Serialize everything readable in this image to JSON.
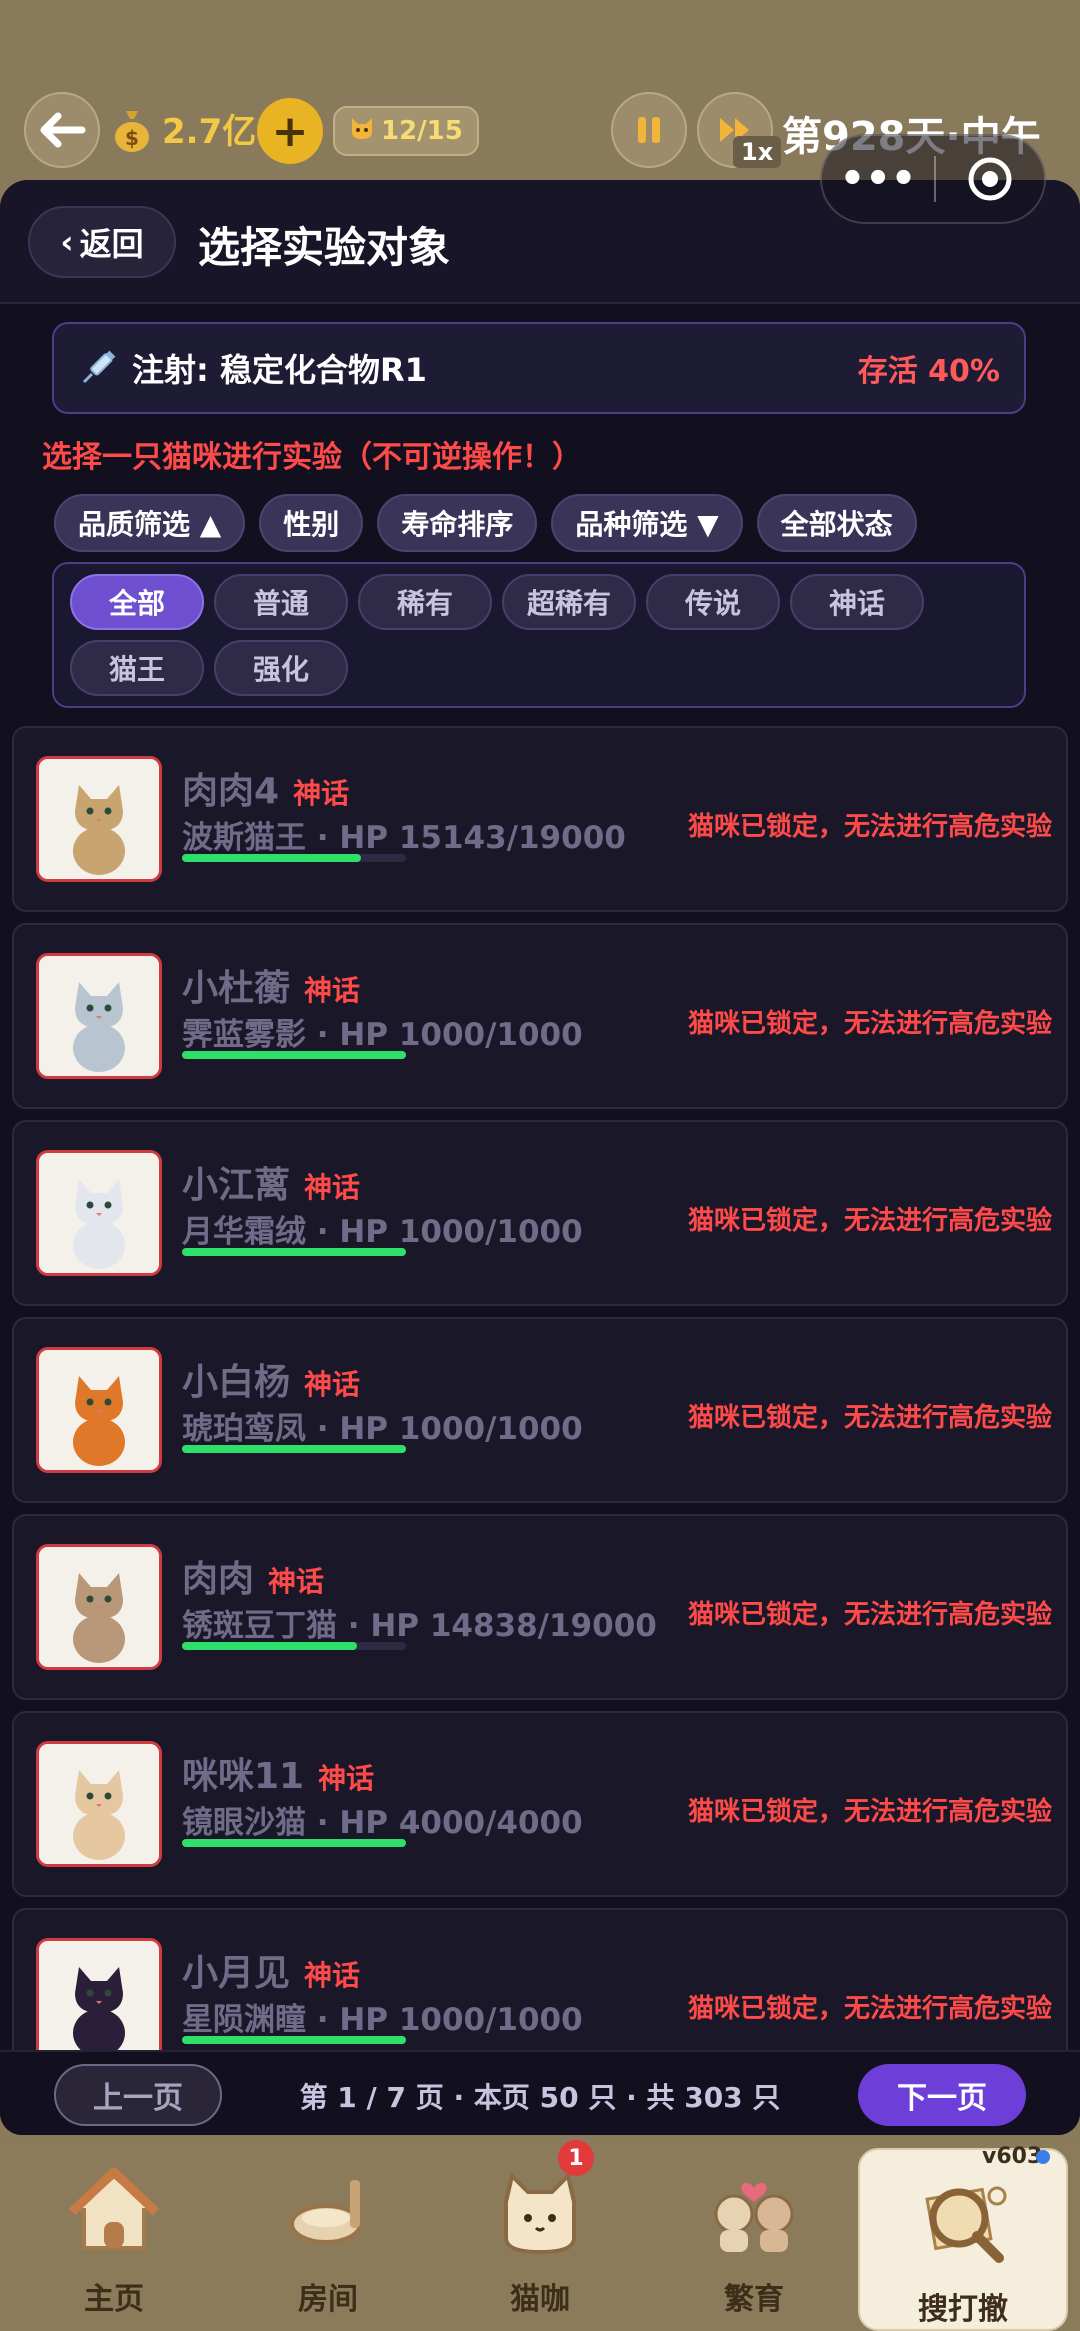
{
  "topbar": {
    "coins": "2.7亿",
    "plus": "+",
    "cat_capacity": "12/15",
    "speed": "1x",
    "day": "第928天·中午"
  },
  "header": {
    "back_label": "返回",
    "title": "选择实验对象"
  },
  "injection": {
    "label": "注射: 稳定化合物R1",
    "survival": "存活 40%"
  },
  "warning": "选择一只猫咪进行实验（不可逆操作！）",
  "filters": [
    "品质筛选 ▲",
    "性别",
    "寿命排序",
    "品种筛选 ▼",
    "全部状态"
  ],
  "quality_chips": [
    "全部",
    "普通",
    "稀有",
    "超稀有",
    "传说",
    "神话",
    "猫王",
    "强化"
  ],
  "cats": [
    {
      "name": "肉肉4",
      "rarity": "神话",
      "breed_hp": "波斯猫王 · HP 15143/19000",
      "hp_fraction": 0.797,
      "status": "猫咪已锁定，无法进行高危实验",
      "fur": "#c8a470"
    },
    {
      "name": "小杜蘅",
      "rarity": "神话",
      "breed_hp": "霁蓝雾影 · HP 1000/1000",
      "hp_fraction": 1.0,
      "status": "猫咪已锁定，无法进行高危实验",
      "fur": "#b8c4d0"
    },
    {
      "name": "小江蓠",
      "rarity": "神话",
      "breed_hp": "月华霜绒 · HP 1000/1000",
      "hp_fraction": 1.0,
      "status": "猫咪已锁定，无法进行高危实验",
      "fur": "#e4e6ee"
    },
    {
      "name": "小白杨",
      "rarity": "神话",
      "breed_hp": "琥珀鸾凤 · HP 1000/1000",
      "hp_fraction": 1.0,
      "status": "猫咪已锁定，无法进行高危实验",
      "fur": "#e0782a"
    },
    {
      "name": "肉肉",
      "rarity": "神话",
      "breed_hp": "锈斑豆丁猫 · HP 14838/19000",
      "hp_fraction": 0.781,
      "status": "猫咪已锁定，无法进行高危实验",
      "fur": "#b89878"
    },
    {
      "name": "咪咪11",
      "rarity": "神话",
      "breed_hp": "镜眼沙猫 · HP 4000/4000",
      "hp_fraction": 1.0,
      "status": "猫咪已锁定，无法进行高危实验",
      "fur": "#e6c8a0"
    },
    {
      "name": "小月见",
      "rarity": "神话",
      "breed_hp": "星陨渊瞳 · HP 1000/1000",
      "hp_fraction": 1.0,
      "status": "猫咪已锁定，无法进行高危实验",
      "fur": "#2a1e38"
    }
  ],
  "pager": {
    "prev": "上一页",
    "info": "第 1 / 7 页 · 本页 50 只 · 共 303 只",
    "next": "下一页"
  },
  "nav": {
    "items": [
      {
        "label": "主页",
        "icon": "house-icon"
      },
      {
        "label": "房间",
        "icon": "room-icon"
      },
      {
        "label": "猫咖",
        "icon": "cat-cafe-icon",
        "badge": "1"
      },
      {
        "label": "繁育",
        "icon": "breeding-icon"
      },
      {
        "label": "搜打撤",
        "icon": "search-map-icon"
      }
    ],
    "version": "v603"
  },
  "colors": {
    "accent": "#6e3fd8",
    "danger": "#ff4a4a",
    "hp": "#2ee06a",
    "gold": "#f3c845"
  }
}
